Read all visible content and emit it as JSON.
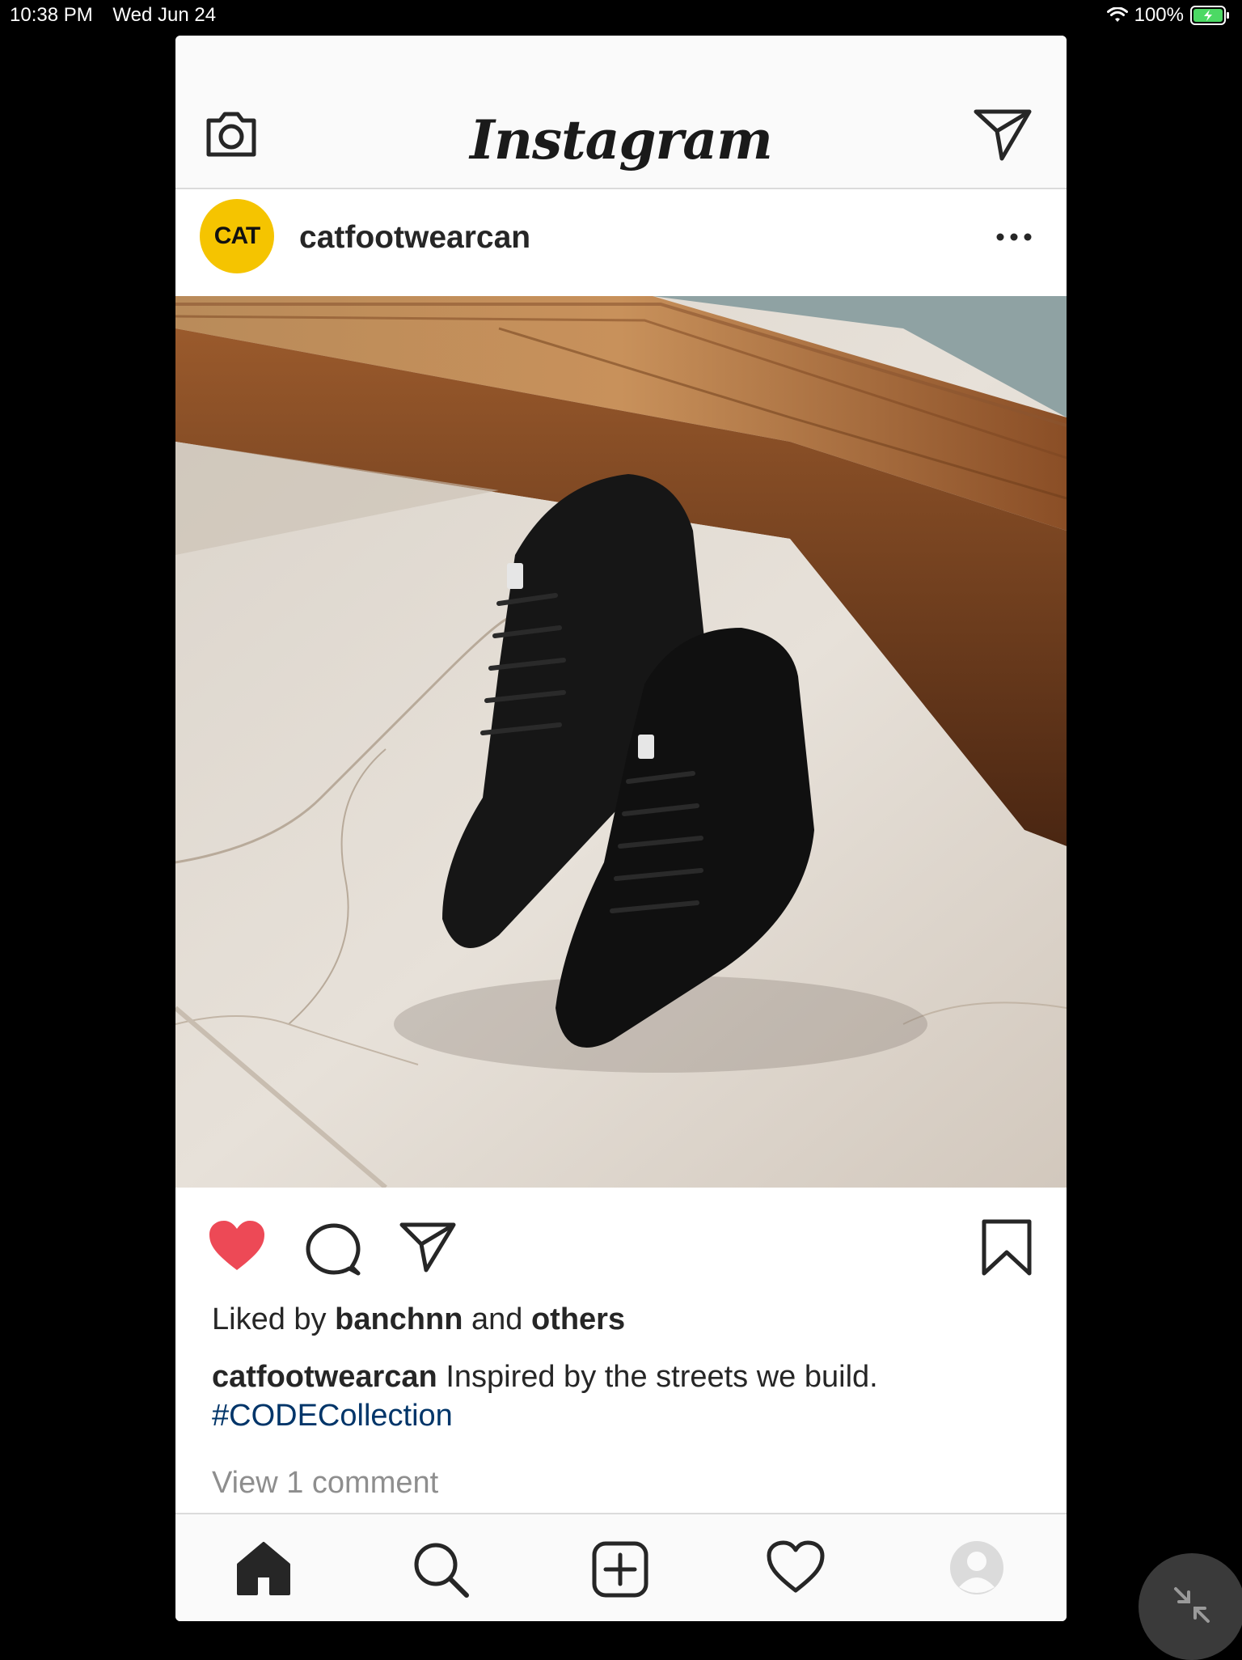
{
  "status_bar": {
    "time": "10:38 PM",
    "date": "Wed Jun 24",
    "battery": "100%"
  },
  "nav": {
    "logo": "Instagram",
    "left_icon": "camera-icon",
    "right_icon": "direct-message-icon"
  },
  "post": {
    "avatar_text": "CAT",
    "username": "catfootwearcan",
    "more_icon": "more-options-icon",
    "image_alt": "Black high-top sneakers on marble step",
    "likes": {
      "prefix": "Liked by",
      "user": "banchnn",
      "middle": "and",
      "others": "others"
    },
    "caption": {
      "user": "catfootwearcan",
      "text": "Inspired by the streets we build.",
      "hashtag": "#CODECollection"
    },
    "view_comments": "View 1 comment"
  },
  "colors": {
    "like": "#ed4956",
    "hashtag": "#003569",
    "avatar_bg": "#f5c400"
  },
  "tabs": [
    {
      "name": "home-icon"
    },
    {
      "name": "search-icon"
    },
    {
      "name": "add-post-icon"
    },
    {
      "name": "activity-heart-icon"
    },
    {
      "name": "profile-icon"
    }
  ]
}
